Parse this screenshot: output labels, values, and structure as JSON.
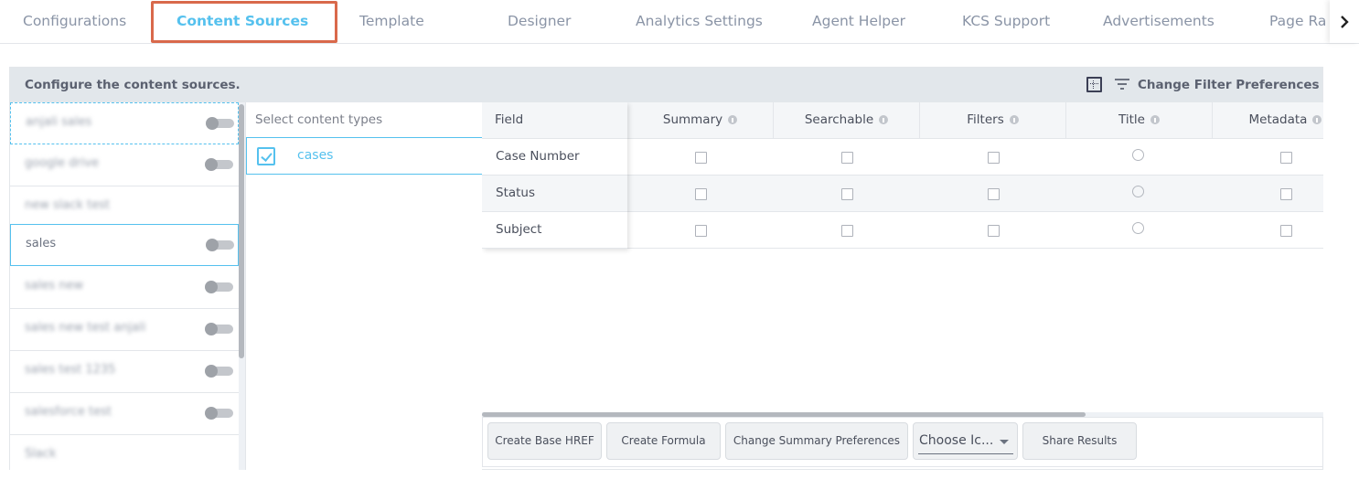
{
  "tabs": [
    {
      "label": "Configurations",
      "active": false
    },
    {
      "label": "Content Sources",
      "active": true
    },
    {
      "label": "Template",
      "active": false
    },
    {
      "label": "Designer",
      "active": false
    },
    {
      "label": "Analytics Settings",
      "active": false
    },
    {
      "label": "Agent Helper",
      "active": false
    },
    {
      "label": "KCS Support",
      "active": false
    },
    {
      "label": "Advertisements",
      "active": false
    },
    {
      "label": "Page Ra",
      "active": false
    }
  ],
  "tab_next_icon": "chevron-right-icon",
  "panel": {
    "title": "Configure the content sources.",
    "grid_icon": "grid-view-icon",
    "filter_icon": "filter-icon",
    "filter_preferences_label": "Change Filter Preferences"
  },
  "sources": [
    {
      "name": "anjali sales",
      "blurred": true,
      "toggle": "off",
      "state": "focused"
    },
    {
      "name": "google drive",
      "blurred": true,
      "toggle": "off",
      "state": ""
    },
    {
      "name": "new slack test",
      "blurred": true,
      "toggle": null,
      "state": ""
    },
    {
      "name": "sales",
      "blurred": false,
      "toggle": "off",
      "state": "selected"
    },
    {
      "name": "sales new",
      "blurred": true,
      "toggle": "off",
      "state": ""
    },
    {
      "name": "sales new test anjali",
      "blurred": true,
      "toggle": "off",
      "state": ""
    },
    {
      "name": "sales test 1235",
      "blurred": true,
      "toggle": "off",
      "state": ""
    },
    {
      "name": "salesforce test",
      "blurred": true,
      "toggle": "off",
      "state": ""
    },
    {
      "name": "Slack",
      "blurred": true,
      "toggle": null,
      "state": ""
    }
  ],
  "content_types": {
    "title": "Select content types",
    "items": [
      {
        "label": "cases",
        "checked": true
      }
    ]
  },
  "fields_table": {
    "field_header": "Field",
    "columns": [
      "Summary",
      "Searchable",
      "Filters",
      "Title",
      "Metadata"
    ],
    "column_types": [
      "checkbox",
      "checkbox",
      "checkbox",
      "radio",
      "checkbox"
    ],
    "rows": [
      {
        "field": "Case Number",
        "summary": false,
        "searchable": false,
        "filters": false,
        "title": false,
        "metadata": false
      },
      {
        "field": "Status",
        "summary": false,
        "searchable": false,
        "filters": false,
        "title": false,
        "metadata": false
      },
      {
        "field": "Subject",
        "summary": false,
        "searchable": false,
        "filters": false,
        "title": false,
        "metadata": false
      }
    ]
  },
  "toolbar": {
    "create_base_href": "Create Base HREF",
    "create_formula": "Create Formula",
    "change_summary_preferences": "Change Summary Preferences",
    "choose_icon_value": "Choose Ic...",
    "share_results": "Share Results"
  },
  "colors": {
    "accent": "#55c1ee",
    "highlight": "#d9694b",
    "header_bg": "#e2e7eb"
  }
}
